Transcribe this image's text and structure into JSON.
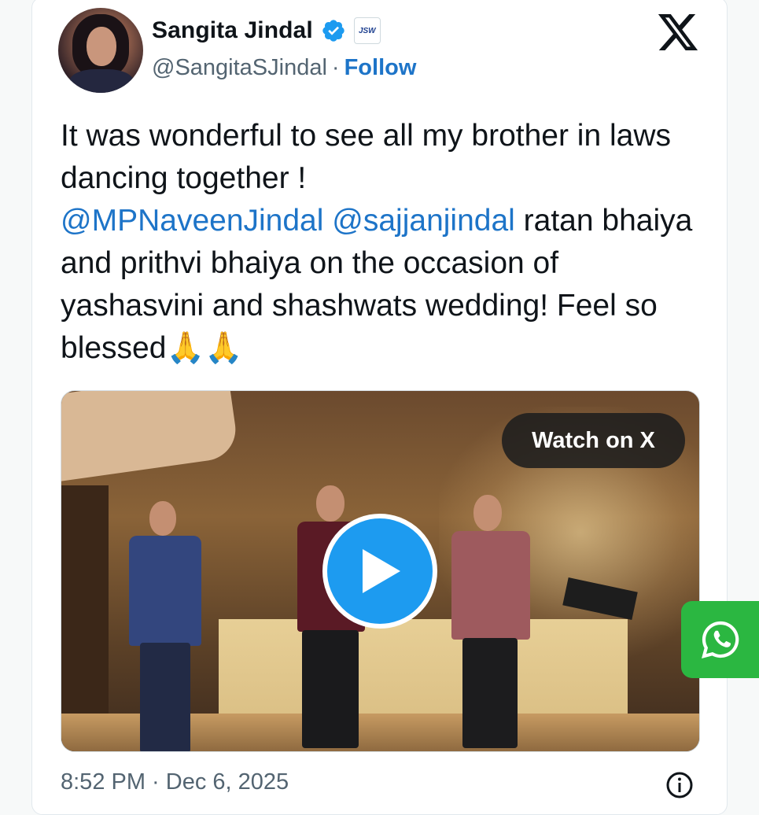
{
  "author": {
    "display_name": "Sangita Jindal",
    "handle": "@SangitaSJindal",
    "separator": "·",
    "follow_label": "Follow",
    "verified_icon": "verified-badge-icon",
    "affiliate_badge": "JSW"
  },
  "tweet": {
    "line1": "It was wonderful to see all my brother in laws dancing together !",
    "mention1": "@MPNaveenJindal",
    "mention2": "@sajjanjindal",
    "line2": "ratan bhaiya and prithvi bhaiya on the occasion of yashasvini and shashwats wedding! Feel so blessed",
    "emoji": "🙏🙏"
  },
  "media": {
    "watch_label": "Watch on X",
    "play_icon": "play-icon"
  },
  "footer": {
    "timestamp": "8:52 PM · Dec 6, 2025",
    "info_icon": "info-icon"
  },
  "colors": {
    "link": "#1d74c8",
    "play": "#1d9bf0",
    "whatsapp": "#2bb741",
    "text": "#0f1419",
    "muted": "#536471"
  }
}
